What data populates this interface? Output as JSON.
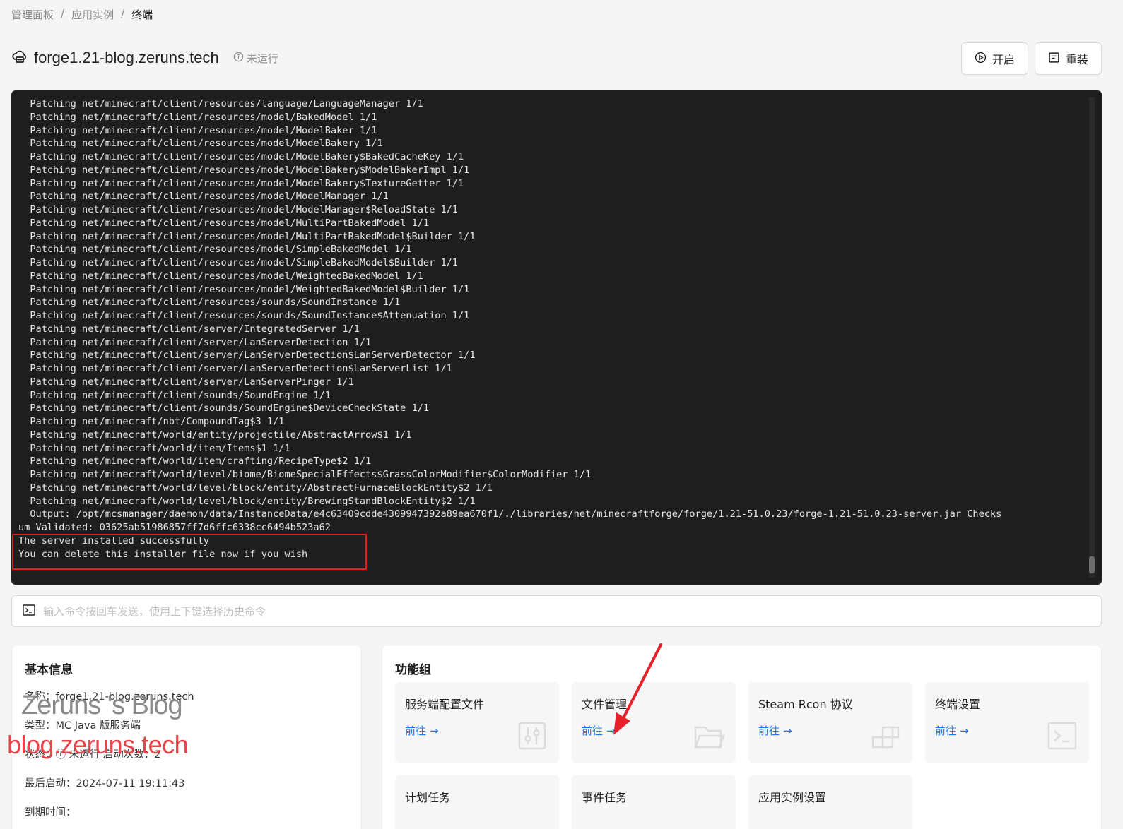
{
  "breadcrumb": [
    "管理面板",
    "应用实例",
    "终端"
  ],
  "breadcrumb_sep": "/",
  "header": {
    "title": "forge1.21-blog.zeruns.tech",
    "status": "未运行",
    "buttons": {
      "start": "开启",
      "reinstall": "重装"
    }
  },
  "terminal": {
    "lines": [
      "  Patching net/minecraft/client/resources/language/LanguageManager 1/1",
      "  Patching net/minecraft/client/resources/model/BakedModel 1/1",
      "  Patching net/minecraft/client/resources/model/ModelBaker 1/1",
      "  Patching net/minecraft/client/resources/model/ModelBakery 1/1",
      "  Patching net/minecraft/client/resources/model/ModelBakery$BakedCacheKey 1/1",
      "  Patching net/minecraft/client/resources/model/ModelBakery$ModelBakerImpl 1/1",
      "  Patching net/minecraft/client/resources/model/ModelBakery$TextureGetter 1/1",
      "  Patching net/minecraft/client/resources/model/ModelManager 1/1",
      "  Patching net/minecraft/client/resources/model/ModelManager$ReloadState 1/1",
      "  Patching net/minecraft/client/resources/model/MultiPartBakedModel 1/1",
      "  Patching net/minecraft/client/resources/model/MultiPartBakedModel$Builder 1/1",
      "  Patching net/minecraft/client/resources/model/SimpleBakedModel 1/1",
      "  Patching net/minecraft/client/resources/model/SimpleBakedModel$Builder 1/1",
      "  Patching net/minecraft/client/resources/model/WeightedBakedModel 1/1",
      "  Patching net/minecraft/client/resources/model/WeightedBakedModel$Builder 1/1",
      "  Patching net/minecraft/client/resources/sounds/SoundInstance 1/1",
      "  Patching net/minecraft/client/resources/sounds/SoundInstance$Attenuation 1/1",
      "  Patching net/minecraft/client/server/IntegratedServer 1/1",
      "  Patching net/minecraft/client/server/LanServerDetection 1/1",
      "  Patching net/minecraft/client/server/LanServerDetection$LanServerDetector 1/1",
      "  Patching net/minecraft/client/server/LanServerDetection$LanServerList 1/1",
      "  Patching net/minecraft/client/server/LanServerPinger 1/1",
      "  Patching net/minecraft/client/sounds/SoundEngine 1/1",
      "  Patching net/minecraft/client/sounds/SoundEngine$DeviceCheckState 1/1",
      "  Patching net/minecraft/nbt/CompoundTag$3 1/1",
      "  Patching net/minecraft/world/entity/projectile/AbstractArrow$1 1/1",
      "  Patching net/minecraft/world/item/Items$1 1/1",
      "  Patching net/minecraft/world/item/crafting/RecipeType$2 1/1",
      "  Patching net/minecraft/world/level/biome/BiomeSpecialEffects$GrassColorModifier$ColorModifier 1/1",
      "  Patching net/minecraft/world/level/block/entity/AbstractFurnaceBlockEntity$2 1/1",
      "  Patching net/minecraft/world/level/block/entity/BrewingStandBlockEntity$2 1/1",
      "  Output: /opt/mcsmanager/daemon/data/InstanceData/e4c63409cdde4309947392a89ea670f1/./libraries/net/minecraftforge/forge/1.21-51.0.23/forge-1.21-51.0.23-server.jar Checks",
      "um Validated: 03625ab51986857ff7d6ffc6338cc6494b523a62",
      "The server installed successfully",
      "You can delete this installer file now if you wish"
    ]
  },
  "command_input": {
    "placeholder": "输入命令按回车发送，使用上下键选择历史命令"
  },
  "basic_info": {
    "title": "基本信息",
    "name": "名称：forge1.21-blog.zeruns.tech",
    "type": "类型：MC Java 版服务端",
    "status": "状态：ⓘ 未运行 启动次数：2",
    "last_start": "最后启动：2024-07-11 19:11:43",
    "expire": "到期时间："
  },
  "function_group": {
    "title": "功能组",
    "link_label": "前往",
    "tiles": [
      {
        "title": "服务端配置文件",
        "icon": "sliders-icon",
        "has_link": true
      },
      {
        "title": "文件管理",
        "icon": "folder-icon",
        "has_link": true
      },
      {
        "title": "Steam Rcon 协议",
        "icon": "blocks-icon",
        "has_link": true
      },
      {
        "title": "终端设置",
        "icon": "terminal-icon",
        "has_link": true
      },
      {
        "title": "计划任务",
        "icon": "",
        "has_link": false
      },
      {
        "title": "事件任务",
        "icon": "",
        "has_link": false
      },
      {
        "title": "应用实例设置",
        "icon": "",
        "has_link": false
      }
    ]
  },
  "watermark": {
    "line1": "Zeruns 's Blog",
    "line2": "blog.zeruns.tech"
  },
  "colors": {
    "accent": "#1677ff",
    "terminal_bg": "#1e1e1e",
    "annotation_red": "#e02020"
  }
}
